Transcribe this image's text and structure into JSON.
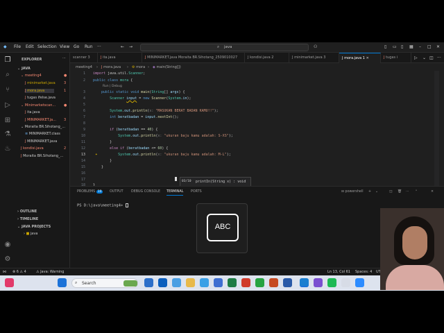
{
  "titlebar": {
    "menu": [
      "File",
      "Edit",
      "Selection",
      "View",
      "Go",
      "Run"
    ],
    "search_text": "java"
  },
  "explorer": {
    "header": "EXPLORER",
    "root": "JAVA",
    "items": [
      {
        "label": "meeting4",
        "type": "folder",
        "status": "●"
      },
      {
        "label": "minimarket.java",
        "type": "file",
        "status": "3"
      },
      {
        "label": "mora.java",
        "type": "file",
        "status": "1"
      },
      {
        "label": "tugas ifelse.java",
        "type": "file",
        "status": ""
      },
      {
        "label": "Minimarketscan...",
        "type": "folder",
        "status": "●"
      },
      {
        "label": "ita.java",
        "type": "file",
        "status": ""
      },
      {
        "label": "MINIMARKET.ja...",
        "type": "file",
        "status": "3"
      },
      {
        "label": "Moraita BR.Sihotang_...",
        "type": "folder",
        "status": ""
      },
      {
        "label": "MINIMARKET.class",
        "type": "file",
        "status": ""
      },
      {
        "label": "MINIMARKET.java",
        "type": "file",
        "status": ""
      },
      {
        "label": "kondisi.java",
        "type": "file",
        "status": "2"
      },
      {
        "label": "Moraita BR.Sihotang_...",
        "type": "file",
        "status": ""
      }
    ],
    "outline": "OUTLINE",
    "timeline": "TIMELINE",
    "java_projects": "JAVA PROJECTS",
    "project": "java"
  },
  "tabs": [
    {
      "label": "scanner 3",
      "active": false
    },
    {
      "label": "ita.java",
      "active": false
    },
    {
      "label": "MINIMARKET.java  Moraita BR.Sihotang_2509010027",
      "active": false
    },
    {
      "label": "kondisi.java 2",
      "active": false
    },
    {
      "label": "minimarket.java 3",
      "active": false
    },
    {
      "label": "mora.java 1",
      "active": true
    },
    {
      "label": "tugas i",
      "active": false
    }
  ],
  "breadcrumb": [
    "meeting4",
    "mora.java",
    "mora",
    "main(String[])"
  ],
  "editor": {
    "code_lens": "Run | Debug",
    "lines": [
      {
        "n": "1",
        "text": "import java.util.Scanner;"
      },
      {
        "n": "2",
        "text": "public class mora {"
      },
      {
        "n": "3",
        "text": "    public static void main(String[] args) {"
      },
      {
        "n": "4",
        "text": "        Scanner input = new Scanner(System.in);"
      },
      {
        "n": "5",
        "text": ""
      },
      {
        "n": "6",
        "text": "        System.out.println(x: \"MASUKAN BERAT BADAN KAMU!!\");"
      },
      {
        "n": "7",
        "text": "        int beratbadan = input.nextInt();"
      },
      {
        "n": "8",
        "text": ""
      },
      {
        "n": "9",
        "text": "        if (beratbadan == 40) {"
      },
      {
        "n": "10",
        "text": "            System.out.println(x: \"ukuran baju kamu adalah: S-XS\");"
      },
      {
        "n": "11",
        "text": "        }"
      },
      {
        "n": "12",
        "text": "        else if (beratbadan <= 60) {"
      },
      {
        "n": "13",
        "text": "            System.out.println(x: \"ukuran baju kamu adalah: M-L\");"
      },
      {
        "n": "14",
        "text": "        }"
      },
      {
        "n": "15",
        "text": "    }"
      },
      {
        "n": "16",
        "text": ""
      },
      {
        "n": "17",
        "text": ""
      },
      {
        "n": "18",
        "text": "}"
      }
    ],
    "current_line": "13",
    "hover_sig": "printIn(String x) : void",
    "hover_count": "03/10"
  },
  "panel": {
    "tabs": [
      "PROBLEMS",
      "OUTPUT",
      "DEBUG CONSOLE",
      "TERMINAL",
      "PORTS"
    ],
    "problems_badge": "10",
    "active_tab": "TERMINAL",
    "shell": "powershell",
    "prompt": "PS D:\\java\\meeting4> "
  },
  "statusbar": {
    "errors": "6",
    "warnings": "4",
    "java": "Java: Warning",
    "position": "Ln 13, Col 61",
    "spaces": "Spaces: 4",
    "encoding": "UTF-8"
  },
  "taskbar": {
    "search_label": "Search"
  },
  "overlay": {
    "abc_label": "ABC"
  }
}
